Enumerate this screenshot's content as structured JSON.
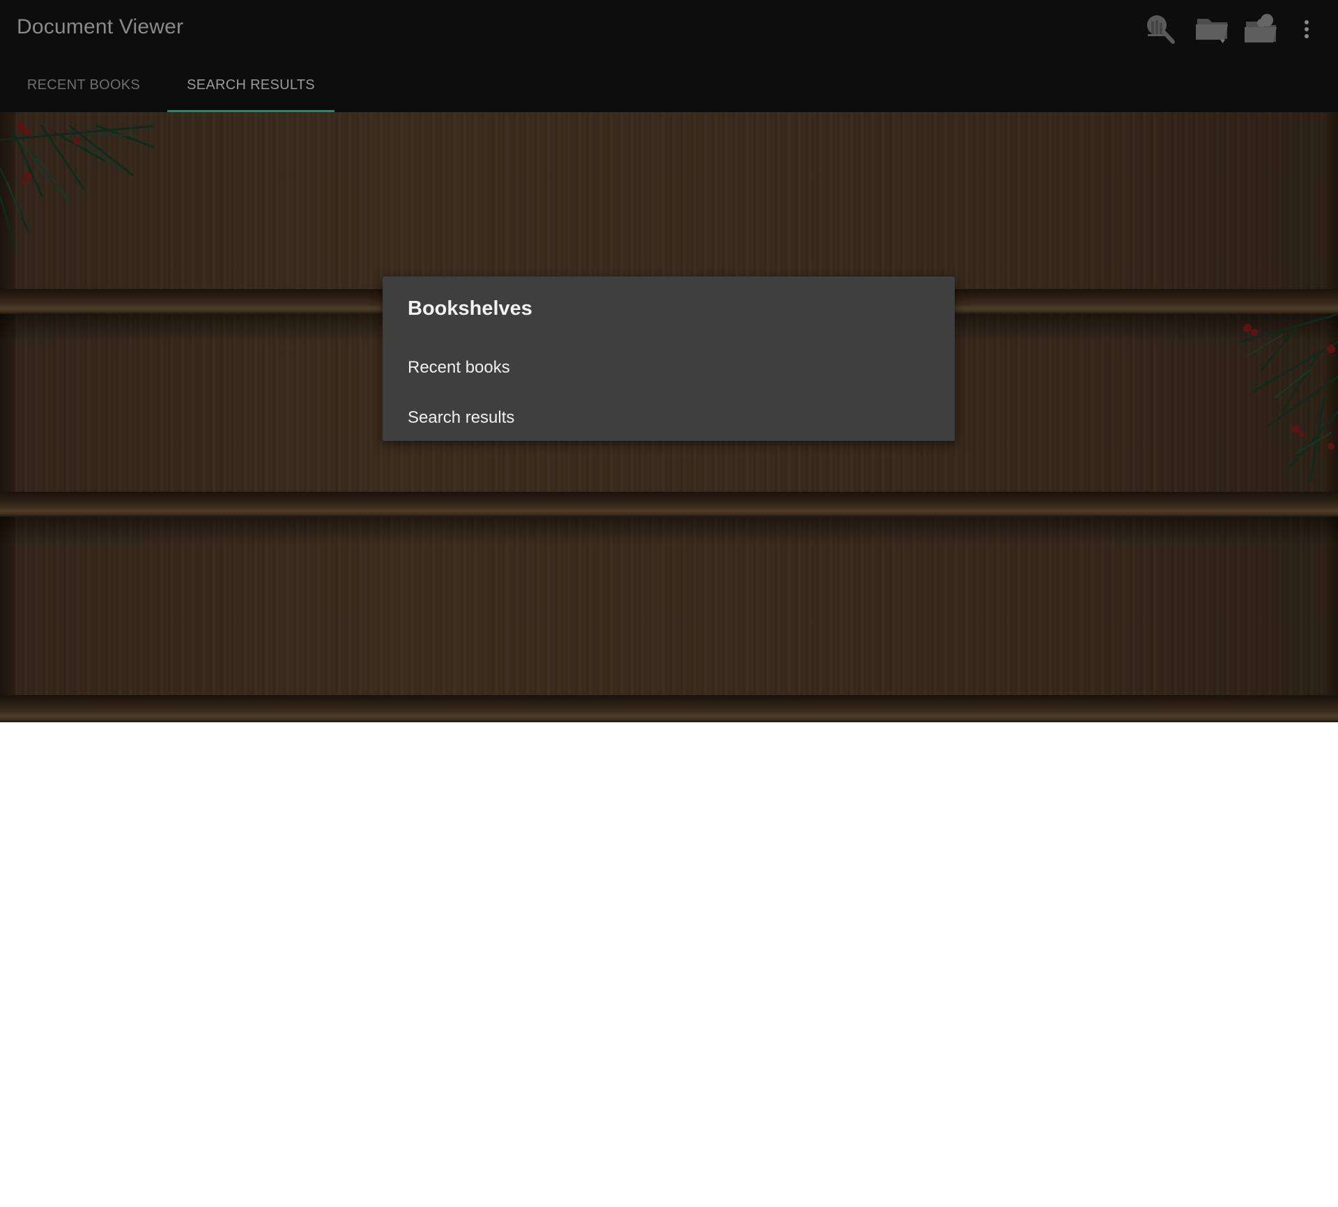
{
  "app": {
    "title": "Document Viewer"
  },
  "toolbar": {
    "icons": [
      {
        "name": "library-search-icon"
      },
      {
        "name": "folder-open-icon"
      },
      {
        "name": "cloud-folder-icon"
      },
      {
        "name": "more-vert-icon"
      }
    ]
  },
  "tabs": [
    {
      "label": "RECENT BOOKS",
      "active": false
    },
    {
      "label": "SEARCH RESULTS",
      "active": true
    }
  ],
  "dialog": {
    "title": "Bookshelves",
    "items": [
      {
        "label": "Recent books"
      },
      {
        "label": "Search results"
      }
    ]
  },
  "colors": {
    "toolbar_bg": "#0d0d0d",
    "tab_indicator": "#3f7f70",
    "dialog_bg": "#3f3f3f",
    "shelf_wood": "#3c2d1e"
  }
}
